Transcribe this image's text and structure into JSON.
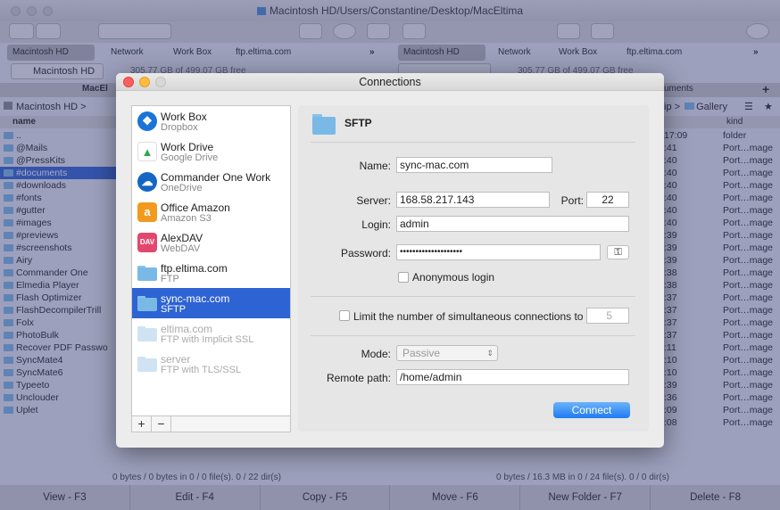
{
  "window": {
    "path_title": "Macintosh HD/Users/Constantine/Desktop/MacEltima"
  },
  "favorites_left": [
    "Macintosh HD",
    "Network",
    "Work Box",
    "ftp.eltima.com"
  ],
  "favorites_right": [
    "Macintosh HD",
    "Network",
    "Work Box",
    "ftp.eltima.com"
  ],
  "more_glyph": "»",
  "drive": {
    "left_name": "Macintosh HD",
    "left_free": "305.77 GB of 499.07 GB free",
    "right_free": "305.77 GB of 499.07 GB free"
  },
  "left_panel": {
    "tab": "MacEl",
    "path": "Macintosh HD",
    "path_sep": ">",
    "col_name": "name",
    "files": [
      "..",
      "@Mails",
      "@PressKits",
      "#documents",
      "#downloads",
      "#fonts",
      "#gutter",
      "#images",
      "#previews",
      "#screenshots",
      "Airy",
      "Commander One",
      "Elmedia Player",
      "Flash Optimizer",
      "FlashDecompilerTrill",
      "Folx",
      "PhotoBulk",
      "Recover PDF Passwo",
      "SyncMate4",
      "SyncMate6",
      "Typeeto",
      "Unclouder",
      "Uplet"
    ],
    "selected_index": 3,
    "status": "0 bytes / 0 bytes in 0 / 0 file(s). 0 / 22 dir(s)"
  },
  "right_panel": {
    "tab": "uments",
    "path_frag": "ip",
    "path_sep": ">",
    "path_folder": "Gallery",
    "col_kind": "kind",
    "rows": [
      {
        "time": "17:09",
        "kind": "folder"
      },
      {
        "time": ":41",
        "kind": "Port…mage"
      },
      {
        "time": ":40",
        "kind": "Port…mage"
      },
      {
        "time": ":40",
        "kind": "Port…mage"
      },
      {
        "time": ":40",
        "kind": "Port…mage"
      },
      {
        "time": ":40",
        "kind": "Port…mage"
      },
      {
        "time": ":40",
        "kind": "Port…mage"
      },
      {
        "time": ":40",
        "kind": "Port…mage"
      },
      {
        "time": ":39",
        "kind": "Port…mage"
      },
      {
        "time": ":39",
        "kind": "Port…mage"
      },
      {
        "time": ":39",
        "kind": "Port…mage"
      },
      {
        "time": ":38",
        "kind": "Port…mage"
      },
      {
        "time": ":38",
        "kind": "Port…mage"
      },
      {
        "time": ":37",
        "kind": "Port…mage"
      },
      {
        "time": ":37",
        "kind": "Port…mage"
      },
      {
        "time": ":37",
        "kind": "Port…mage"
      },
      {
        "time": ":37",
        "kind": "Port…mage"
      },
      {
        "time": ":11",
        "kind": "Port…mage"
      },
      {
        "time": ":10",
        "kind": "Port…mage"
      },
      {
        "time": ":10",
        "kind": "Port…mage"
      },
      {
        "time": ":39",
        "kind": "Port…mage"
      },
      {
        "time": ":36",
        "kind": "Port…mage"
      },
      {
        "time": ":09",
        "kind": "Port…mage"
      },
      {
        "time": ":08",
        "kind": "Port…mage"
      }
    ],
    "status": "0 bytes / 16.3 MB in 0 / 24 file(s). 0 / 0 dir(s)"
  },
  "function_keys": [
    "View - F3",
    "Edit - F4",
    "Copy - F5",
    "Move - F6",
    "New Folder - F7",
    "Delete - F8"
  ],
  "dialog": {
    "title": "Connections",
    "connections": [
      {
        "name": "Work Box",
        "type": "Dropbox",
        "icon": "dropbox-icon",
        "color": "#1a74d8",
        "state": "normal"
      },
      {
        "name": "Work Drive",
        "type": "Google Drive",
        "icon": "google-drive-icon",
        "color": "#ffffff",
        "state": "normal"
      },
      {
        "name": "Commander One Work",
        "type": "OneDrive",
        "icon": "onedrive-icon",
        "color": "#1366c4",
        "state": "normal"
      },
      {
        "name": "Office Amazon",
        "type": "Amazon S3",
        "icon": "amazon-s3-icon",
        "color": "#f29a1f",
        "state": "normal"
      },
      {
        "name": "AlexDAV",
        "type": "WebDAV",
        "icon": "webdav-icon",
        "color": "#e2486f",
        "state": "normal"
      },
      {
        "name": "ftp.eltima.com",
        "type": "FTP",
        "icon": "folder-icon",
        "color": "#7ab9e6",
        "state": "normal"
      },
      {
        "name": "sync-mac.com",
        "type": "SFTP",
        "icon": "folder-icon",
        "color": "#7ab9e6",
        "state": "selected"
      },
      {
        "name": "eltima.com",
        "type": "FTP with Implicit SSL",
        "icon": "folder-icon",
        "color": "#cfe3f3",
        "state": "dim"
      },
      {
        "name": "server",
        "type": "FTP with TLS/SSL",
        "icon": "folder-icon",
        "color": "#cfe3f3",
        "state": "dim"
      }
    ],
    "footer": {
      "add": "+",
      "remove": "−"
    },
    "detail": {
      "heading": "SFTP",
      "name_label": "Name:",
      "name_value": "sync-mac.com",
      "server_label": "Server:",
      "server_value": "168.58.217.143",
      "port_label": "Port:",
      "port_value": "22",
      "login_label": "Login:",
      "login_value": "admin",
      "password_label": "Password:",
      "password_value": "••••••••••••••••••••",
      "anonymous_label": "Anonymous login",
      "limit_label": "Limit the number of simultaneous connections to",
      "limit_value": "5",
      "mode_label": "Mode:",
      "mode_value": "Passive",
      "remote_label": "Remote path:",
      "remote_value": "/home/admin",
      "connect_label": "Connect"
    }
  }
}
